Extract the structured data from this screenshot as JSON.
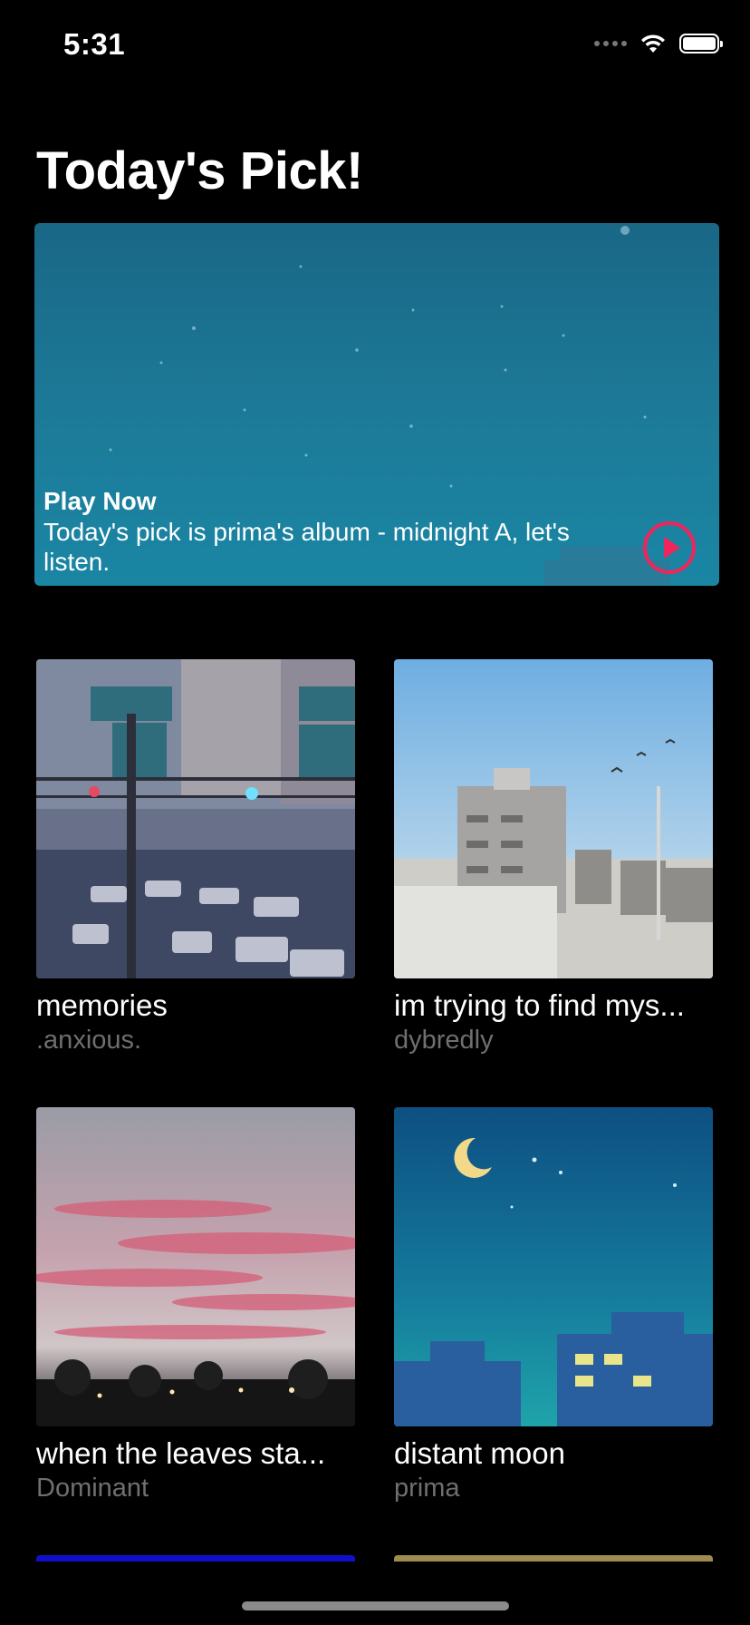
{
  "status_bar": {
    "time": "5:31"
  },
  "page": {
    "title": "Today's Pick!"
  },
  "hero": {
    "kicker": "Play Now",
    "description": "Today's pick is prima's album - midnight A, let's listen."
  },
  "albums": [
    {
      "title": "memories",
      "artist": ".anxious."
    },
    {
      "title": "im trying to find mys...",
      "artist": "dybredly"
    },
    {
      "title": "when the leaves sta...",
      "artist": "Dominant"
    },
    {
      "title": "distant moon",
      "artist": "prima"
    }
  ],
  "colors": {
    "background": "#000000",
    "accent": "#f0255b",
    "secondary_text": "#6f6f6f"
  }
}
